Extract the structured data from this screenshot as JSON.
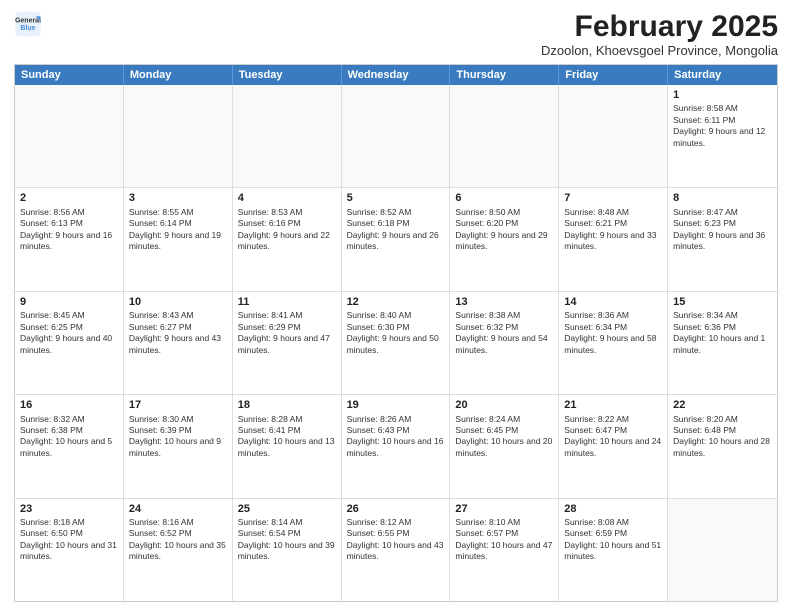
{
  "logo": {
    "line1": "General",
    "line2": "Blue"
  },
  "title": "February 2025",
  "subtitle": "Dzoolon, Khoevsgoel Province, Mongolia",
  "headers": [
    "Sunday",
    "Monday",
    "Tuesday",
    "Wednesday",
    "Thursday",
    "Friday",
    "Saturday"
  ],
  "weeks": [
    [
      {
        "day": "",
        "detail": ""
      },
      {
        "day": "",
        "detail": ""
      },
      {
        "day": "",
        "detail": ""
      },
      {
        "day": "",
        "detail": ""
      },
      {
        "day": "",
        "detail": ""
      },
      {
        "day": "",
        "detail": ""
      },
      {
        "day": "1",
        "detail": "Sunrise: 8:58 AM\nSunset: 6:11 PM\nDaylight: 9 hours and 12 minutes."
      }
    ],
    [
      {
        "day": "2",
        "detail": "Sunrise: 8:56 AM\nSunset: 6:13 PM\nDaylight: 9 hours and 16 minutes."
      },
      {
        "day": "3",
        "detail": "Sunrise: 8:55 AM\nSunset: 6:14 PM\nDaylight: 9 hours and 19 minutes."
      },
      {
        "day": "4",
        "detail": "Sunrise: 8:53 AM\nSunset: 6:16 PM\nDaylight: 9 hours and 22 minutes."
      },
      {
        "day": "5",
        "detail": "Sunrise: 8:52 AM\nSunset: 6:18 PM\nDaylight: 9 hours and 26 minutes."
      },
      {
        "day": "6",
        "detail": "Sunrise: 8:50 AM\nSunset: 6:20 PM\nDaylight: 9 hours and 29 minutes."
      },
      {
        "day": "7",
        "detail": "Sunrise: 8:48 AM\nSunset: 6:21 PM\nDaylight: 9 hours and 33 minutes."
      },
      {
        "day": "8",
        "detail": "Sunrise: 8:47 AM\nSunset: 6:23 PM\nDaylight: 9 hours and 36 minutes."
      }
    ],
    [
      {
        "day": "9",
        "detail": "Sunrise: 8:45 AM\nSunset: 6:25 PM\nDaylight: 9 hours and 40 minutes."
      },
      {
        "day": "10",
        "detail": "Sunrise: 8:43 AM\nSunset: 6:27 PM\nDaylight: 9 hours and 43 minutes."
      },
      {
        "day": "11",
        "detail": "Sunrise: 8:41 AM\nSunset: 6:29 PM\nDaylight: 9 hours and 47 minutes."
      },
      {
        "day": "12",
        "detail": "Sunrise: 8:40 AM\nSunset: 6:30 PM\nDaylight: 9 hours and 50 minutes."
      },
      {
        "day": "13",
        "detail": "Sunrise: 8:38 AM\nSunset: 6:32 PM\nDaylight: 9 hours and 54 minutes."
      },
      {
        "day": "14",
        "detail": "Sunrise: 8:36 AM\nSunset: 6:34 PM\nDaylight: 9 hours and 58 minutes."
      },
      {
        "day": "15",
        "detail": "Sunrise: 8:34 AM\nSunset: 6:36 PM\nDaylight: 10 hours and 1 minute."
      }
    ],
    [
      {
        "day": "16",
        "detail": "Sunrise: 8:32 AM\nSunset: 6:38 PM\nDaylight: 10 hours and 5 minutes."
      },
      {
        "day": "17",
        "detail": "Sunrise: 8:30 AM\nSunset: 6:39 PM\nDaylight: 10 hours and 9 minutes."
      },
      {
        "day": "18",
        "detail": "Sunrise: 8:28 AM\nSunset: 6:41 PM\nDaylight: 10 hours and 13 minutes."
      },
      {
        "day": "19",
        "detail": "Sunrise: 8:26 AM\nSunset: 6:43 PM\nDaylight: 10 hours and 16 minutes."
      },
      {
        "day": "20",
        "detail": "Sunrise: 8:24 AM\nSunset: 6:45 PM\nDaylight: 10 hours and 20 minutes."
      },
      {
        "day": "21",
        "detail": "Sunrise: 8:22 AM\nSunset: 6:47 PM\nDaylight: 10 hours and 24 minutes."
      },
      {
        "day": "22",
        "detail": "Sunrise: 8:20 AM\nSunset: 6:48 PM\nDaylight: 10 hours and 28 minutes."
      }
    ],
    [
      {
        "day": "23",
        "detail": "Sunrise: 8:18 AM\nSunset: 6:50 PM\nDaylight: 10 hours and 31 minutes."
      },
      {
        "day": "24",
        "detail": "Sunrise: 8:16 AM\nSunset: 6:52 PM\nDaylight: 10 hours and 35 minutes."
      },
      {
        "day": "25",
        "detail": "Sunrise: 8:14 AM\nSunset: 6:54 PM\nDaylight: 10 hours and 39 minutes."
      },
      {
        "day": "26",
        "detail": "Sunrise: 8:12 AM\nSunset: 6:55 PM\nDaylight: 10 hours and 43 minutes."
      },
      {
        "day": "27",
        "detail": "Sunrise: 8:10 AM\nSunset: 6:57 PM\nDaylight: 10 hours and 47 minutes."
      },
      {
        "day": "28",
        "detail": "Sunrise: 8:08 AM\nSunset: 6:59 PM\nDaylight: 10 hours and 51 minutes."
      },
      {
        "day": "",
        "detail": ""
      }
    ]
  ]
}
